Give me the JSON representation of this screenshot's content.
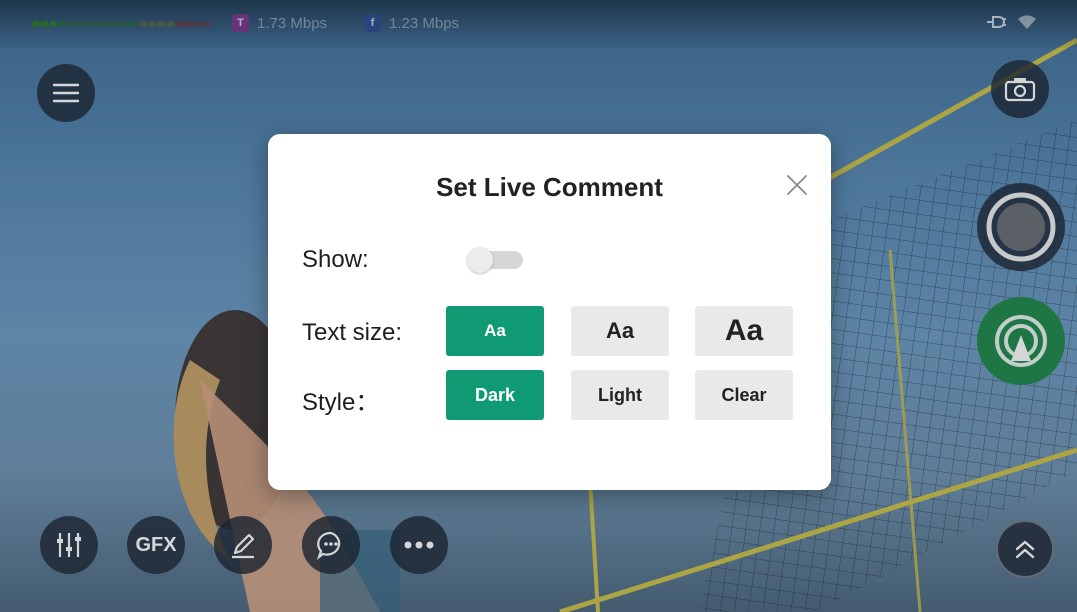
{
  "status_bar": {
    "stream1": {
      "badge": "T",
      "label": "1.73 Mbps",
      "badge_color": "#7a3a8c"
    },
    "stream2": {
      "badge": "f",
      "label": "1.23 Mbps",
      "badge_color": "#2d4f8f"
    }
  },
  "dialog": {
    "title": "Set Live Comment",
    "show_label": "Show:",
    "show_enabled": false,
    "text_size_label": "Text size:",
    "text_size_options": [
      "Aa",
      "Aa",
      "Aa"
    ],
    "text_size_selected": 0,
    "style_label": "Style：",
    "style_options": [
      "Dark",
      "Light",
      "Clear"
    ],
    "style_selected": 0
  },
  "toolbar": {
    "gfx_label": "GFX"
  },
  "colors": {
    "accent_green": "#0f9a73",
    "live_green": "#1f8a4a",
    "net_yellow": "#cfc24a"
  },
  "icons": [
    "menu-icon",
    "camera-icon",
    "record-icon",
    "broadcast-icon",
    "mixer-icon",
    "pen-icon",
    "comment-icon",
    "more-icon",
    "double-chevron-up-icon",
    "close-icon",
    "power-plug-icon",
    "wifi-icon"
  ]
}
